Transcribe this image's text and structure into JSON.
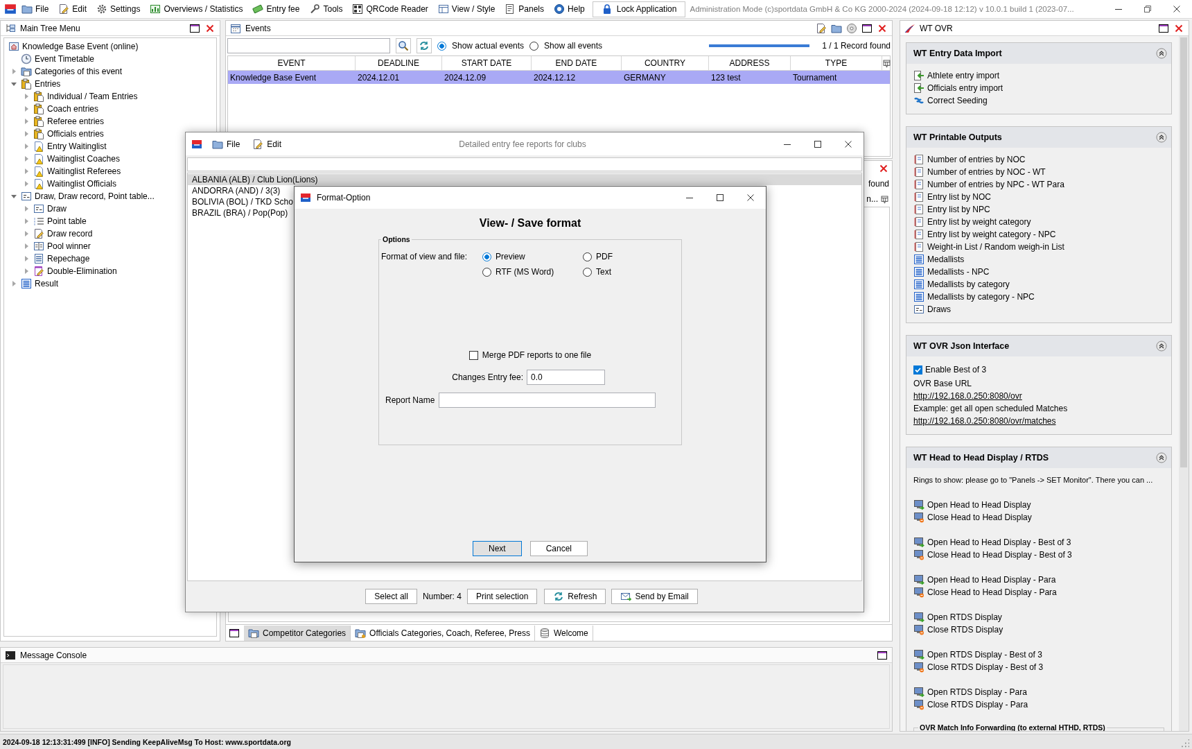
{
  "menu_bar": {
    "items": [
      {
        "label": "File",
        "kind": "folder"
      },
      {
        "label": "Edit",
        "kind": "edit"
      },
      {
        "label": "Settings",
        "kind": "gear"
      },
      {
        "label": "Overviews / Statistics",
        "kind": "chart"
      },
      {
        "label": "Entry fee",
        "kind": "money"
      },
      {
        "label": "Tools",
        "kind": "wrench"
      },
      {
        "label": "QRCode Reader",
        "kind": "qr"
      },
      {
        "label": "View / Style",
        "kind": "view"
      },
      {
        "label": "Panels",
        "kind": "panels"
      },
      {
        "label": "Help",
        "kind": "help"
      }
    ],
    "lock_button": "Lock Application",
    "title": "Administration Mode (c)sportdata GmbH & Co KG 2000-2024 (2024-09-18 12:12)  v 10.0.1 build 1 (2023-07..."
  },
  "main_tree": {
    "title": "Main Tree Menu",
    "root": {
      "label": "Knowledge Base Event (online)",
      "kind": "home",
      "children": [
        {
          "label": "Event Timetable",
          "kind": "clock"
        },
        {
          "label": "Categories of this event",
          "kind": "categories",
          "expanded": false
        },
        {
          "label": "Entries",
          "kind": "clipboard",
          "expanded": true,
          "children": [
            {
              "label": "Individual / Team Entries",
              "kind": "clipboard",
              "expanded": false
            },
            {
              "label": "Coach entries",
              "kind": "clipboard",
              "expanded": false
            },
            {
              "label": "Referee entries",
              "kind": "clipboard",
              "expanded": false
            },
            {
              "label": "Officials entries",
              "kind": "clipboard",
              "expanded": false
            },
            {
              "label": "Entry Waitinglist",
              "kind": "warning",
              "expanded": false
            },
            {
              "label": "Waitinglist Coaches",
              "kind": "warning",
              "expanded": false
            },
            {
              "label": "Waitinglist Referees",
              "kind": "warning",
              "expanded": false
            },
            {
              "label": "Waitinglist Officials",
              "kind": "warning",
              "expanded": false
            }
          ]
        },
        {
          "label": "Draw, Draw record, Point table...",
          "kind": "draw",
          "expanded": true,
          "children": [
            {
              "label": "Draw",
              "kind": "draw",
              "expanded": false
            },
            {
              "label": "Point table",
              "kind": "points",
              "expanded": false
            },
            {
              "label": "Draw record",
              "kind": "record",
              "expanded": false
            },
            {
              "label": "Pool winner",
              "kind": "pool",
              "expanded": false
            },
            {
              "label": "Repechage",
              "kind": "repechage",
              "expanded": false
            },
            {
              "label": "Double-Elimination",
              "kind": "double",
              "expanded": false
            }
          ]
        },
        {
          "label": "Result",
          "kind": "result",
          "expanded": false
        }
      ]
    }
  },
  "events": {
    "title": "Events",
    "filters": [
      {
        "label": "Show actual events",
        "selected": true
      },
      {
        "label": "Show all events",
        "selected": false
      }
    ],
    "progress": {
      "level": 1
    },
    "record_count": "1 / 1 Record found",
    "table": {
      "columns": [
        "EVENT",
        "DEADLINE",
        "START DATE",
        "END DATE",
        "COUNTRY",
        "ADDRESS",
        "TYPE"
      ],
      "rows": [
        {
          "cells": [
            "Knowledge Base Event",
            "2024.12.01",
            "2024.12.09",
            "2024.12.12",
            "GERMANY",
            "123 test",
            "Tournament"
          ],
          "selected": true
        }
      ]
    }
  },
  "categories_panel": {
    "record_count": "found",
    "column_3": "n...",
    "tabs": [
      {
        "label": "Competitor Categories",
        "kind": "categories",
        "selected": true
      },
      {
        "label": "Officials Categories, Coach, Referee, Press",
        "kind": "officials",
        "selected": false
      },
      {
        "label": "Welcome",
        "kind": "welcome",
        "selected": false
      }
    ]
  },
  "entry_fee_window": {
    "title": "Detailed entry fee reports for clubs",
    "menu": [
      {
        "label": "File",
        "kind": "folder"
      },
      {
        "label": "Edit",
        "kind": "edit"
      }
    ],
    "clubs": [
      {
        "label": "ALBANIA (ALB) / Club Lion(Lions)",
        "selected": true
      },
      {
        "label": "ANDORRA (AND) / 3(3)",
        "selected": false
      },
      {
        "label": "BOLIVIA (BOL) / TKD Scho",
        "selected": false
      },
      {
        "label": "BRAZIL (BRA) / Pop(Pop)",
        "selected": false
      }
    ],
    "select_all": "Select all",
    "count": "Number: 4",
    "print": "Print selection",
    "refresh": "Refresh",
    "email": "Send by Email"
  },
  "format_dialog": {
    "title": "Format-Option",
    "heading": "View- / Save format",
    "group_title": "Options",
    "format_label": "Format of view and file:",
    "formats": [
      {
        "label": "Preview",
        "selected": true
      },
      {
        "label": "PDF",
        "selected": false
      },
      {
        "label": "RTF (MS Word)",
        "selected": false
      },
      {
        "label": "Text",
        "selected": false
      }
    ],
    "merge_pdf": {
      "label": "Merge PDF reports to one file",
      "checked": false
    },
    "entry_fee": {
      "label": "Changes Entry fee:",
      "value": "0.0"
    },
    "report_name": {
      "label": "Report Name"
    },
    "buttons": [
      "Next",
      "Cancel"
    ]
  },
  "ovr_panel": {
    "title": "WT OVR",
    "sections": [
      {
        "title": "WT Entry Data Import",
        "expanded": true,
        "items": [
          {
            "kind": "import",
            "label": "Athlete entry import"
          },
          {
            "kind": "import",
            "label": "Officials entry import"
          },
          {
            "kind": "seeding",
            "label": "Correct Seeding"
          }
        ]
      },
      {
        "title": "WT Printable Outputs",
        "expanded": true,
        "items": [
          {
            "kind": "report",
            "label": "Number of entries by NOC"
          },
          {
            "kind": "report",
            "label": "Number of entries by NOC - WT"
          },
          {
            "kind": "report",
            "label": "Number of entries by NPC - WT Para"
          },
          {
            "kind": "report",
            "label": "Entry list by NOC"
          },
          {
            "kind": "report",
            "label": "Entry list by NPC"
          },
          {
            "kind": "report",
            "label": "Entry list by weight category"
          },
          {
            "kind": "report",
            "label": "Entry list by weight category - NPC"
          },
          {
            "kind": "report",
            "label": "Weight-in List / Random weigh-in List"
          },
          {
            "kind": "table",
            "label": "Medallists"
          },
          {
            "kind": "table",
            "label": "Medallists - NPC"
          },
          {
            "kind": "table",
            "label": "Medallists by category"
          },
          {
            "kind": "table",
            "label": "Medallists by category - NPC"
          },
          {
            "kind": "draw",
            "label": "Draws"
          }
        ]
      },
      {
        "title": "WT OVR Json Interface",
        "expanded": true,
        "items": [
          {
            "kind": "checkbox",
            "label": "Enable Best of 3",
            "checked": true
          },
          {
            "kind": "text",
            "label": "OVR Base URL"
          },
          {
            "kind": "link",
            "label": "http://192.168.0.250:8080/ovr"
          },
          {
            "kind": "text",
            "label": "Example: get all open scheduled Matches"
          },
          {
            "kind": "link",
            "label": "http://192.168.0.250:8080/ovr/matches"
          }
        ]
      },
      {
        "title": "WT Head to Head Display / RTDS",
        "expanded": true,
        "items": [
          {
            "kind": "note",
            "label": "Rings to show: please go to \"Panels -> SET Monitor\". There you can ..."
          },
          {
            "kind": "open",
            "label": "Open Head to Head Display"
          },
          {
            "kind": "close",
            "label": "Close Head to Head Display"
          },
          {
            "kind": "open",
            "label": "Open Head to Head Display - Best of 3"
          },
          {
            "kind": "close",
            "label": "Close Head to Head Display - Best of 3"
          },
          {
            "kind": "open",
            "label": "Open Head to Head Display - Para"
          },
          {
            "kind": "close",
            "label": "Close Head to Head Display - Para"
          },
          {
            "kind": "open",
            "label": "Open RTDS Display"
          },
          {
            "kind": "close",
            "label": "Close RTDS Display"
          },
          {
            "kind": "open",
            "label": "Open RTDS Display - Best of 3"
          },
          {
            "kind": "close",
            "label": "Close RTDS Display - Best of 3"
          },
          {
            "kind": "open",
            "label": "Open RTDS Display - Para"
          },
          {
            "kind": "close",
            "label": "Close RTDS Display - Para"
          }
        ],
        "group_title": "OVR Match Info Forwarding (to external HTHD, RTDS)"
      }
    ]
  },
  "message_console": {
    "title": "Message Console"
  },
  "status_bar": {
    "message": "2024-09-18 12:13:31:499 [INFO] Sending KeepAliveMsg To Host: www.sportdata.org"
  }
}
